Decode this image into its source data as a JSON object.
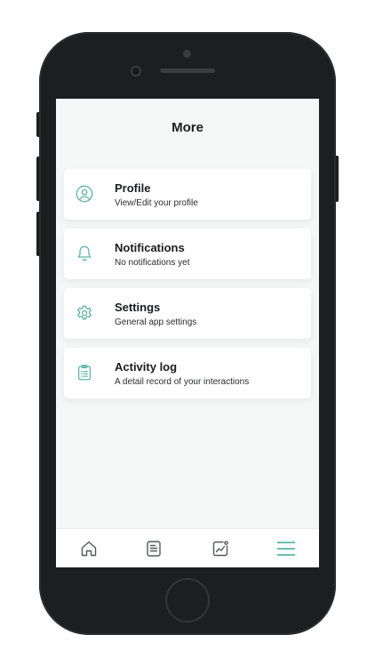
{
  "screen": {
    "title": "More"
  },
  "menu": {
    "items": [
      {
        "label": "Profile",
        "subtitle": "View/Edit your profile",
        "icon": "user-circle-icon"
      },
      {
        "label": "Notifications",
        "subtitle": "No notifications yet",
        "icon": "bell-icon"
      },
      {
        "label": "Settings",
        "subtitle": "General app settings",
        "icon": "gear-icon"
      },
      {
        "label": "Activity log",
        "subtitle": "A detail record of your interactions",
        "icon": "clipboard-list-icon"
      }
    ]
  },
  "bottom_nav": {
    "items": [
      {
        "icon": "home-icon",
        "active": false
      },
      {
        "icon": "journal-icon",
        "active": false
      },
      {
        "icon": "chart-icon",
        "active": false
      },
      {
        "icon": "menu-icon",
        "active": true
      }
    ]
  },
  "colors": {
    "accent": "#5ab5a6",
    "icon_inactive": "#55585c",
    "screen_background": "#f4f7f6",
    "card_background": "#ffffff",
    "device_body": "#1d1e20"
  }
}
